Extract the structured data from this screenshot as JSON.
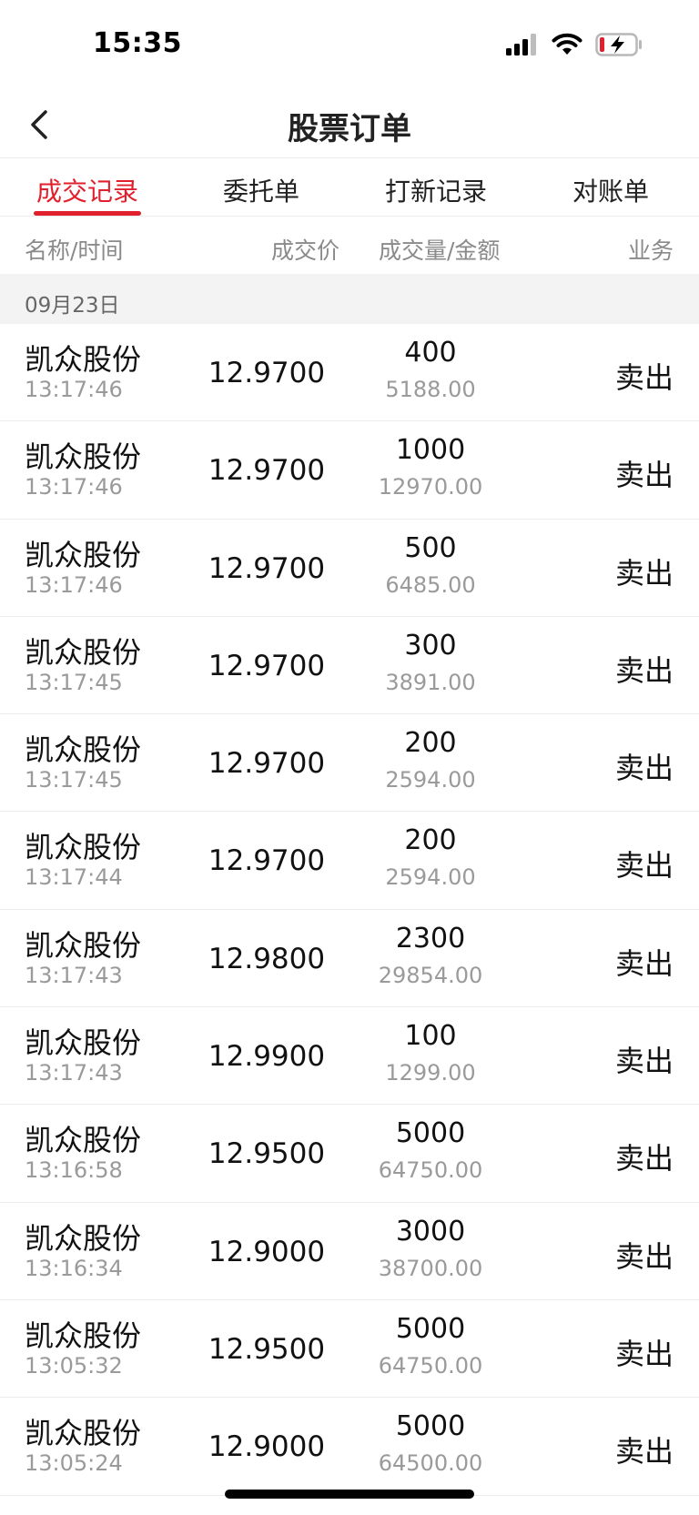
{
  "status_bar": {
    "time": "15:35"
  },
  "nav": {
    "title": "股票订单"
  },
  "tabs": [
    {
      "label": "成交记录",
      "active": true
    },
    {
      "label": "委托单",
      "active": false
    },
    {
      "label": "打新记录",
      "active": false
    },
    {
      "label": "对账单",
      "active": false
    }
  ],
  "columns": {
    "name_time": "名称/时间",
    "price": "成交价",
    "qty_amount": "成交量/金额",
    "action": "业务"
  },
  "date_group": "09月23日",
  "rows": [
    {
      "name": "凯众股份",
      "time": "13:17:46",
      "price": "12.9700",
      "qty": "400",
      "amount": "5188.00",
      "action": "卖出"
    },
    {
      "name": "凯众股份",
      "time": "13:17:46",
      "price": "12.9700",
      "qty": "1000",
      "amount": "12970.00",
      "action": "卖出"
    },
    {
      "name": "凯众股份",
      "time": "13:17:46",
      "price": "12.9700",
      "qty": "500",
      "amount": "6485.00",
      "action": "卖出"
    },
    {
      "name": "凯众股份",
      "time": "13:17:45",
      "price": "12.9700",
      "qty": "300",
      "amount": "3891.00",
      "action": "卖出"
    },
    {
      "name": "凯众股份",
      "time": "13:17:45",
      "price": "12.9700",
      "qty": "200",
      "amount": "2594.00",
      "action": "卖出"
    },
    {
      "name": "凯众股份",
      "time": "13:17:44",
      "price": "12.9700",
      "qty": "200",
      "amount": "2594.00",
      "action": "卖出"
    },
    {
      "name": "凯众股份",
      "time": "13:17:43",
      "price": "12.9800",
      "qty": "2300",
      "amount": "29854.00",
      "action": "卖出"
    },
    {
      "name": "凯众股份",
      "time": "13:17:43",
      "price": "12.9900",
      "qty": "100",
      "amount": "1299.00",
      "action": "卖出"
    },
    {
      "name": "凯众股份",
      "time": "13:16:58",
      "price": "12.9500",
      "qty": "5000",
      "amount": "64750.00",
      "action": "卖出"
    },
    {
      "name": "凯众股份",
      "time": "13:16:34",
      "price": "12.9000",
      "qty": "3000",
      "amount": "38700.00",
      "action": "卖出"
    },
    {
      "name": "凯众股份",
      "time": "13:05:32",
      "price": "12.9500",
      "qty": "5000",
      "amount": "64750.00",
      "action": "卖出"
    },
    {
      "name": "凯众股份",
      "time": "13:05:24",
      "price": "12.9000",
      "qty": "5000",
      "amount": "64500.00",
      "action": "卖出"
    }
  ],
  "colors": {
    "accent": "#e0202d",
    "secondary_text": "#9a9a9a",
    "date_bg": "#f3f3f3"
  },
  "icons": [
    "signal-icon",
    "wifi-icon",
    "battery-charging-icon",
    "back-chevron-icon"
  ]
}
